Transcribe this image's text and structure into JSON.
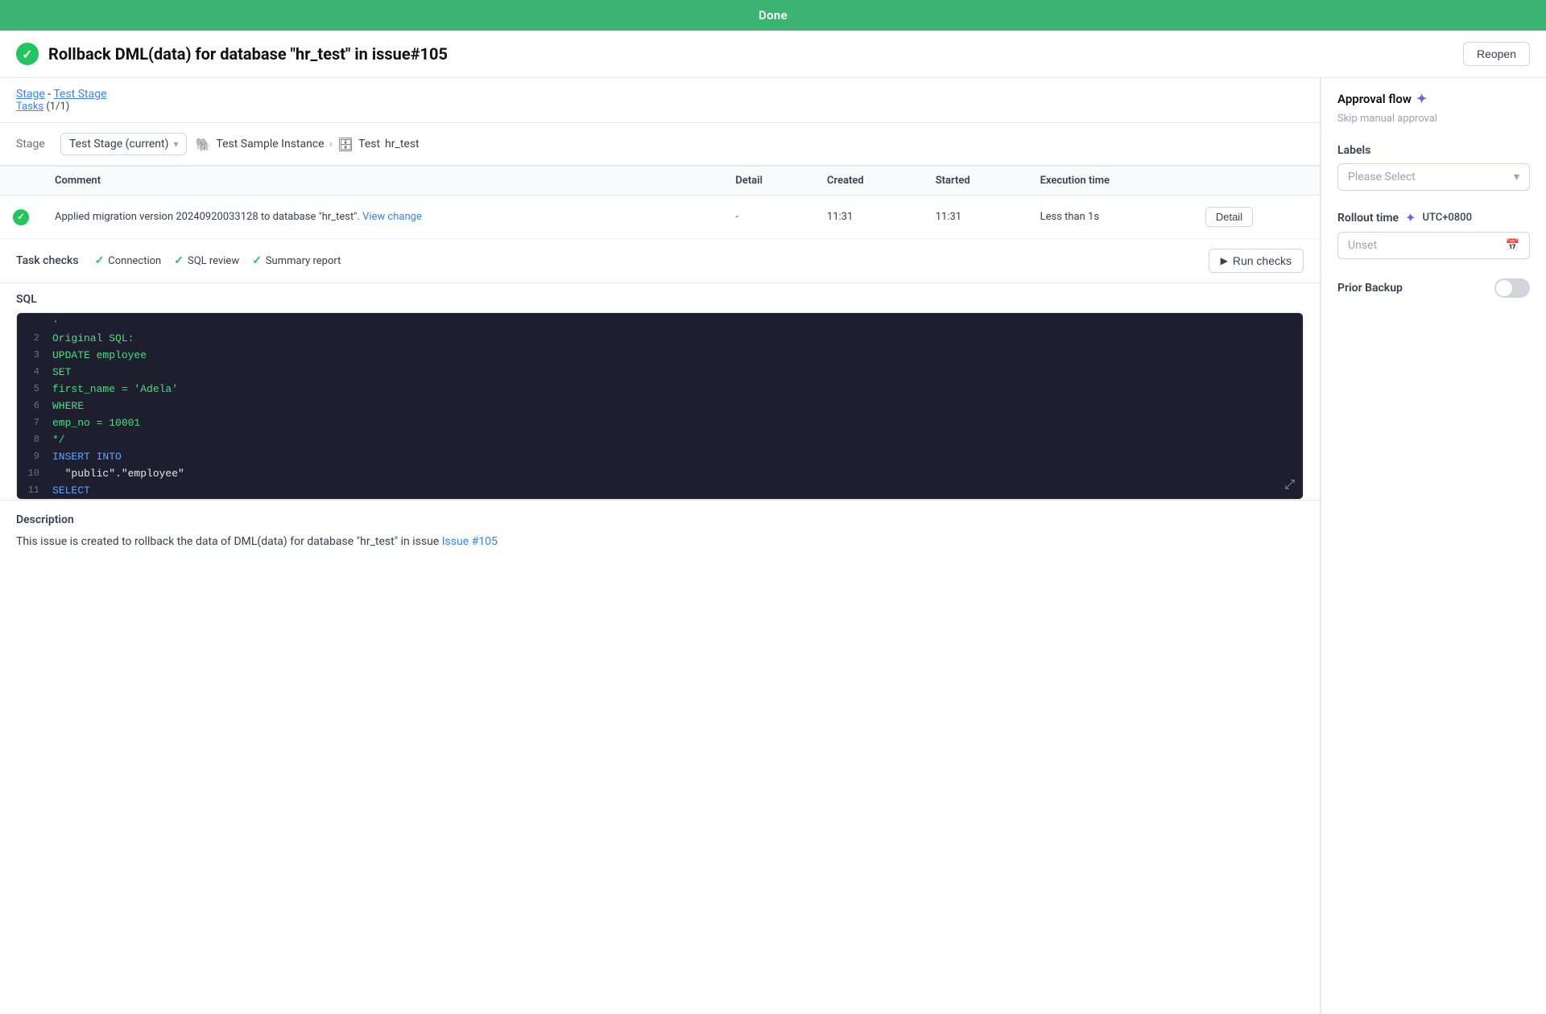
{
  "topBar": {
    "label": "Done"
  },
  "header": {
    "title": "Rollback DML(data) for database \"hr_test\" in issue#105",
    "reopenBtn": "Reopen"
  },
  "stageBreadcrumb": {
    "stageLink": "Stage",
    "separator": " - ",
    "stageNameLink": "Test Stage",
    "tasksLabel": "Tasks",
    "tasksCount": "(1/1)"
  },
  "stageRow": {
    "label": "Stage",
    "currentStage": "Test Stage (current)",
    "instanceName": "Test Sample Instance",
    "dbLabel": "Test",
    "dbName": "hr_test"
  },
  "tableHeaders": {
    "comment": "Comment",
    "detail": "Detail",
    "created": "Created",
    "started": "Started",
    "executionTime": "Execution time"
  },
  "tableRow": {
    "comment": "Applied migration version 20240920033128 to database \"hr_test\".",
    "viewChange": "View change",
    "detail": "-",
    "created": "11:31",
    "started": "11:31",
    "executionTime": "Less than 1s",
    "detailBtn": "Detail"
  },
  "taskChecks": {
    "label": "Task checks",
    "items": [
      {
        "label": "Connection"
      },
      {
        "label": "SQL review"
      },
      {
        "label": "Summary report"
      }
    ],
    "runChecksBtn": "Run checks"
  },
  "sql": {
    "label": "SQL",
    "lines": [
      {
        "num": "2",
        "content": "Original SQL:",
        "style": "green"
      },
      {
        "num": "3",
        "content": "UPDATE employee",
        "style": "green"
      },
      {
        "num": "4",
        "content": "SET",
        "style": "green"
      },
      {
        "num": "5",
        "content": "first_name = 'Adela'",
        "style": "green"
      },
      {
        "num": "6",
        "content": "WHERE",
        "style": "green"
      },
      {
        "num": "7",
        "content": "emp_no = 10001",
        "style": "green"
      },
      {
        "num": "8",
        "content": "*/",
        "style": "green"
      },
      {
        "num": "9",
        "content": "INSERT INTO",
        "style": "blue"
      },
      {
        "num": "10",
        "content": "  \"public\".\"employee\"",
        "style": "white"
      },
      {
        "num": "11",
        "content": "SELECT",
        "style": "blue"
      }
    ]
  },
  "description": {
    "title": "Description",
    "text": "This issue is created to rollback the data of DML(data) for database \"hr_test\" in issue ",
    "linkText": "Issue #105",
    "linkUrl": "#"
  },
  "rightSidebar": {
    "approvalFlow": {
      "title": "Approval flow",
      "skipManual": "Skip manual approval"
    },
    "labels": {
      "title": "Labels",
      "placeholder": "Please Select"
    },
    "rolloutTime": {
      "title": "Rollout time",
      "timezone": "UTC+0800",
      "unsetPlaceholder": "Unset"
    },
    "priorBackup": {
      "title": "Prior Backup"
    }
  }
}
